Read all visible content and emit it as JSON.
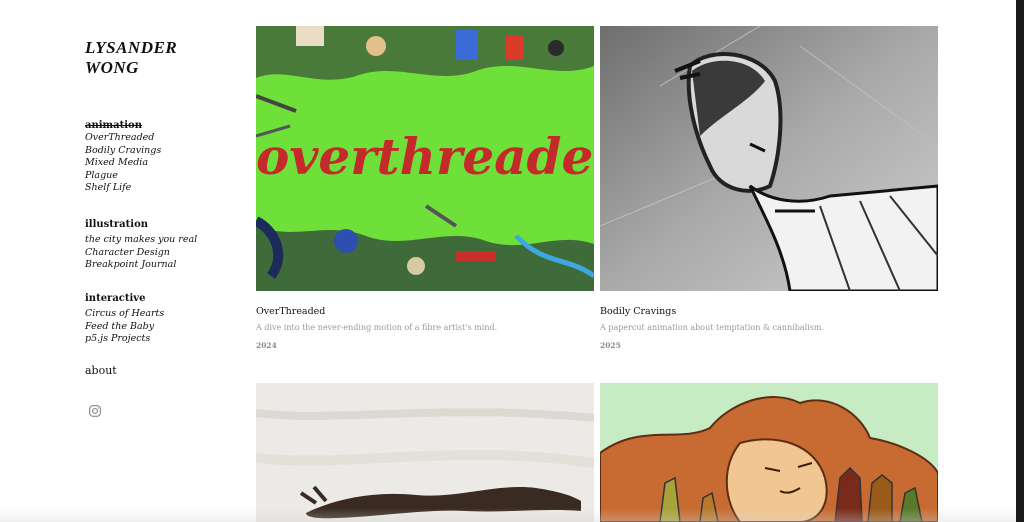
{
  "site": {
    "title_line1": "LYSANDER",
    "title_line2": "WONG"
  },
  "nav": {
    "animation": {
      "heading": "animation",
      "items": [
        "OverThreaded",
        "Bodily Cravings",
        "Mixed Media",
        "Plague",
        "Shelf Life"
      ]
    },
    "illustration": {
      "heading": "illustration",
      "items": [
        "the city makes you real",
        "Character Design",
        "Breakpoint Journal"
      ]
    },
    "interactive": {
      "heading": "interactive",
      "items": [
        "Circus of Hearts",
        "Feed the Baby",
        "p5.js Projects"
      ]
    },
    "about": "about",
    "social_icon": "instagram-icon"
  },
  "projects": [
    {
      "title": "OverThreaded",
      "description": "A dive into the never-ending motion of a fibre artist's mind.",
      "year": "2024",
      "thumb_text": "overthreaded"
    },
    {
      "title": "Bodily Cravings",
      "description": "A papercut animation about temptation & cannibalism.",
      "year": "2025"
    },
    {
      "title": "",
      "description": "",
      "year": ""
    },
    {
      "title": "",
      "description": "",
      "year": ""
    }
  ],
  "colors": {
    "overthreaded_bg": "#6fe03a",
    "thread_red": "#c52a2a",
    "illustration_bg": "#c7ecc4",
    "hair": "#c86b32"
  }
}
